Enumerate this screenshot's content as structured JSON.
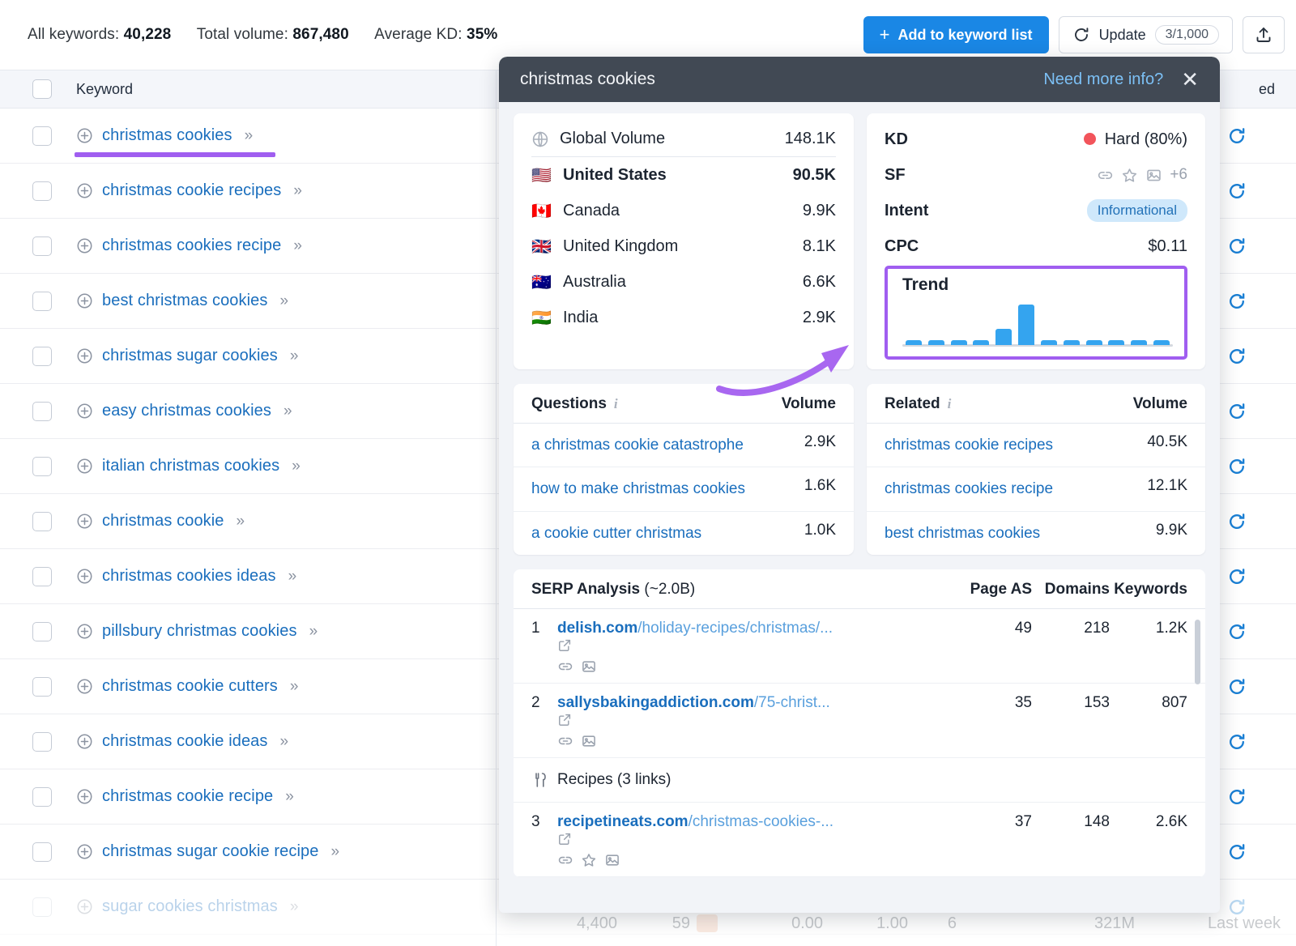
{
  "topbar": {
    "all_keywords_label": "All keywords:",
    "all_keywords_value": "40,228",
    "total_volume_label": "Total volume:",
    "total_volume_value": "867,480",
    "average_kd_label": "Average KD:",
    "average_kd_value": "35%",
    "add_button": "Add to keyword list",
    "add_button_plus": "+",
    "update_button": "Update",
    "update_count": "3/1,000",
    "export_icon": "upload-icon"
  },
  "table": {
    "header_checkbox": "select-all",
    "header_keyword": "Keyword",
    "header_updated": "ed",
    "rows": [
      {
        "keyword": "christmas cookies",
        "highlighted": true
      },
      {
        "keyword": "christmas cookie recipes"
      },
      {
        "keyword": "christmas cookies recipe"
      },
      {
        "keyword": "best christmas cookies"
      },
      {
        "keyword": "christmas sugar cookies"
      },
      {
        "keyword": "easy christmas cookies"
      },
      {
        "keyword": "italian christmas cookies"
      },
      {
        "keyword": "christmas cookie"
      },
      {
        "keyword": "christmas cookies ideas"
      },
      {
        "keyword": "pillsbury christmas cookies"
      },
      {
        "keyword": "christmas cookie cutters"
      },
      {
        "keyword": "christmas cookie ideas"
      },
      {
        "keyword": "christmas cookie recipe"
      },
      {
        "keyword": "christmas sugar cookie recipe"
      },
      {
        "keyword": "sugar cookies christmas",
        "faded": true
      }
    ],
    "bottom_partial_row": {
      "volume": "4,400",
      "kd": "59",
      "cpc": "0.00",
      "com": "1.00",
      "results_n": "6",
      "results": "321M",
      "updated": "Last week"
    }
  },
  "popup": {
    "title": "christmas cookies",
    "need_more_info": "Need more info?",
    "close_icon": "close-icon",
    "volume_card": {
      "global_label": "Global Volume",
      "global_value": "148.1K",
      "global_icon": "globe-icon",
      "countries": [
        {
          "flag": "🇺🇸",
          "name": "United States",
          "value": "90.5K",
          "bold": true
        },
        {
          "flag": "🇨🇦",
          "name": "Canada",
          "value": "9.9K"
        },
        {
          "flag": "🇬🇧",
          "name": "United Kingdom",
          "value": "8.1K"
        },
        {
          "flag": "🇦🇺",
          "name": "Australia",
          "value": "6.6K"
        },
        {
          "flag": "🇮🇳",
          "name": "India",
          "value": "2.9K"
        }
      ]
    },
    "metrics": {
      "kd_label": "KD",
      "kd_value": "Hard (80%)",
      "kd_color": "#f2545b",
      "sf_label": "SF",
      "sf_icons": [
        "link-icon",
        "star-icon",
        "image-icon"
      ],
      "sf_more": "+6",
      "intent_label": "Intent",
      "intent_value": "Informational",
      "cpc_label": "CPC",
      "cpc_value": "$0.11"
    },
    "trend": {
      "title": "Trend",
      "highlight_color": "#a05ef0"
    },
    "questions": {
      "title": "Questions",
      "info_icon": "info-icon",
      "volume_header": "Volume",
      "items": [
        {
          "text": "a christmas cookie catastrophe",
          "volume": "2.9K"
        },
        {
          "text": "how to make christmas cookies",
          "volume": "1.6K"
        },
        {
          "text": "a cookie cutter christmas",
          "volume": "1.0K"
        }
      ]
    },
    "related": {
      "title": "Related",
      "info_icon": "info-icon",
      "volume_header": "Volume",
      "items": [
        {
          "text": "christmas cookie recipes",
          "volume": "40.5K"
        },
        {
          "text": "christmas cookies recipe",
          "volume": "12.1K"
        },
        {
          "text": "best christmas cookies",
          "volume": "9.9K"
        }
      ]
    },
    "serp": {
      "title": "SERP Analysis",
      "subtitle": "(~2.0B)",
      "col_page_as": "Page AS",
      "col_domains": "Domains",
      "col_keywords": "Keywords",
      "rows": [
        {
          "type": "result",
          "num": "1",
          "domain": "delish.com",
          "path": "/holiday-recipes/christmas/...",
          "ext_icon": "external-link-icon",
          "feature_icons": [
            "link-icon",
            "image-icon"
          ],
          "page_as": "49",
          "domains": "218",
          "keywords": "1.2K"
        },
        {
          "type": "result",
          "num": "2",
          "domain": "sallysbakingaddiction.com",
          "path": "/75-christ...",
          "ext_icon": "external-link-icon",
          "feature_icons": [
            "link-icon",
            "image-icon"
          ],
          "page_as": "35",
          "domains": "153",
          "keywords": "807"
        },
        {
          "type": "group",
          "icon": "cutlery-icon",
          "label": "Recipes (3 links)"
        },
        {
          "type": "result",
          "num": "3",
          "domain": "recipetineats.com",
          "path": "/christmas-cookies-...",
          "ext_icon": "external-link-icon",
          "feature_icons": [
            "link-icon",
            "star-icon",
            "image-icon"
          ],
          "page_as": "37",
          "domains": "148",
          "keywords": "2.6K"
        }
      ]
    }
  },
  "chart_data": {
    "type": "bar",
    "title": "Trend",
    "categories": [
      "1",
      "2",
      "3",
      "4",
      "5",
      "6",
      "7",
      "8",
      "9",
      "10",
      "11",
      "12"
    ],
    "values": [
      5,
      5,
      5,
      5,
      20,
      50,
      5,
      5,
      5,
      5,
      5,
      5
    ],
    "ylim": [
      0,
      50
    ],
    "xlabel": "",
    "ylabel": "",
    "grid": false,
    "bar_color": "#34a4ef"
  }
}
